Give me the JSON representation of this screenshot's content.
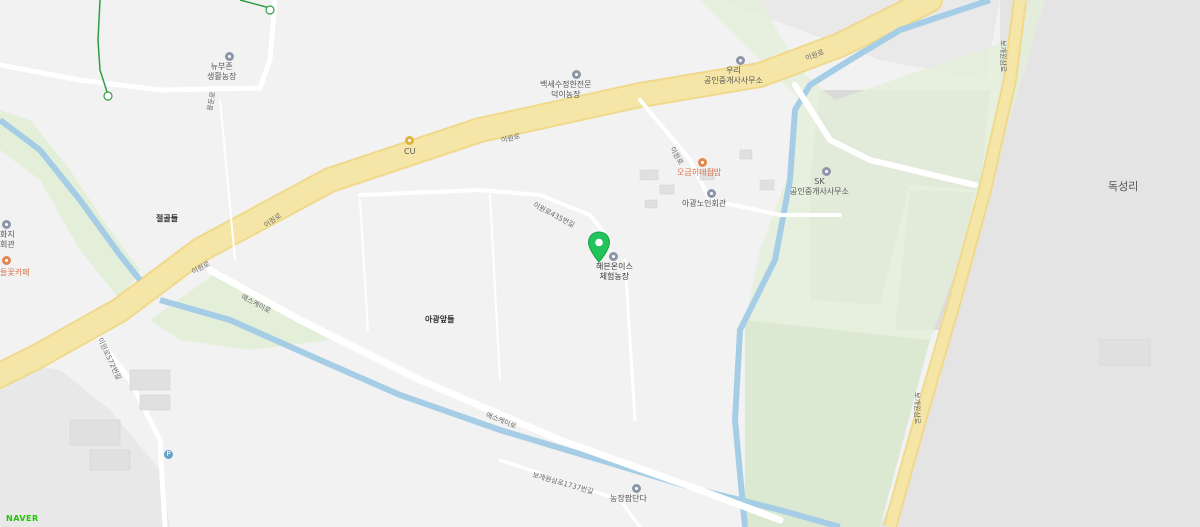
{
  "map": {
    "colors": {
      "background": "#f2f2f2",
      "highway": "#f5e6a8",
      "river": "#a6cde6",
      "greenery": "#dbe9d2",
      "hills": "#e6e6e6",
      "pin": "#21c45b"
    },
    "areas": {
      "dokseong_ri": "독성리",
      "jeolgoldeul": "절골들",
      "ajangapdeul": "아광앞들"
    },
    "roads": {
      "iwon_ro_1": "이원로",
      "iwon_ro_2": "이원로",
      "iwon_ro_3": "이원로",
      "iwon_ro_4": "이원로",
      "iwon_ro_5": "이원로",
      "aseukei_ro_1": "애스케이로",
      "aseukei_ro_2": "애스케이로",
      "iwonro_side": "이원로435번길",
      "yongdun_ro": "용둔로",
      "bogaewonsam_ro_1": "보개원삼로",
      "bogaewonsam_ro_2": "보개원삼로",
      "bogaewonsam_1737": "보개원삼로1737번길",
      "left_road": "이원로572번길",
      "ig_ro": "이원로"
    },
    "pois": {
      "nubuzen": "뉴부존\n생활농장",
      "baekse": "백세수정한전문\n덕이농장",
      "uri": "우리\n공인중개사사무소",
      "cu": "CU",
      "ogeum": "오금허데집밥",
      "iwang_senior": "아광노인회관",
      "sk": "SK\n공인중개사사무소",
      "hwaji": "화지\n회관",
      "flower_cafe": "들꽃카페",
      "selected": "해븐온이스\n체험농장",
      "bottom": "농장팜단다"
    },
    "pin_label": "selected location",
    "brand": "NAVER"
  }
}
